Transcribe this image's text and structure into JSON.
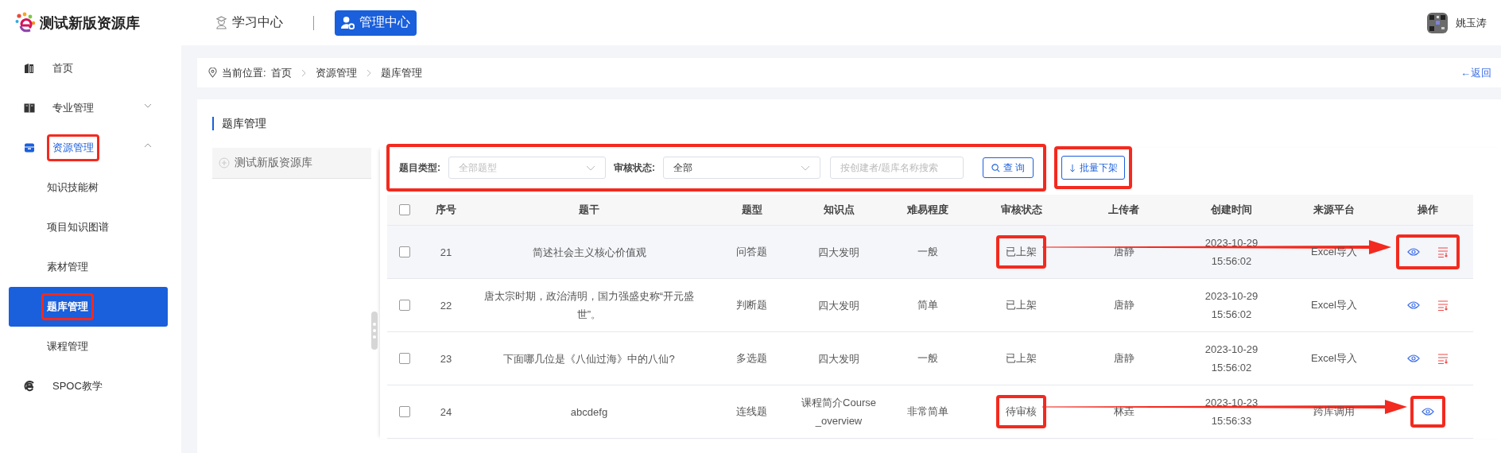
{
  "header": {
    "app_title": "测试新版资源库",
    "nav": [
      {
        "label": "学习中心",
        "kind": "learn",
        "selected": false
      },
      {
        "label": "管理中心",
        "kind": "admin",
        "selected": true
      }
    ],
    "user": {
      "name": "姚玉涛"
    }
  },
  "sidebar": {
    "items": [
      {
        "label": "首页",
        "selected": false,
        "highlighted": false
      },
      {
        "label": "专业管理",
        "selected": false,
        "highlighted": false,
        "expanded": false
      },
      {
        "label": "资源管理",
        "selected": false,
        "highlighted": true,
        "expanded": true,
        "children": [
          {
            "label": "知识技能树",
            "selected": false,
            "highlighted": false
          },
          {
            "label": "项目知识图谱",
            "selected": false,
            "highlighted": false
          },
          {
            "label": "素材管理",
            "selected": false,
            "highlighted": false
          },
          {
            "label": "题库管理",
            "selected": true,
            "highlighted": true
          },
          {
            "label": "课程管理",
            "selected": false,
            "highlighted": false
          }
        ]
      },
      {
        "label": "SPOC教学",
        "selected": false,
        "highlighted": false
      }
    ]
  },
  "breadcrumb": {
    "prefix": "当前位置:",
    "items": [
      "首页",
      "资源管理",
      "题库管理"
    ],
    "back": "←返回"
  },
  "page_title": "题库管理",
  "tree": {
    "items": [
      {
        "label": "测试新版资源库"
      }
    ]
  },
  "filters": {
    "highlighted": true,
    "type_label": "题目类型:",
    "type_select": {
      "placeholder": "全部题型"
    },
    "status_label": "审核状态:",
    "status_select": {
      "value": "全部"
    },
    "search": {
      "placeholder": "按创建者/题库名称搜索"
    },
    "query_button": "查 询",
    "batch_button": {
      "label": "批量下架",
      "highlighted": true
    }
  },
  "table": {
    "header_checked": false,
    "columns": [
      "序号",
      "题干",
      "题型",
      "知识点",
      "难易程度",
      "审核状态",
      "上传者",
      "创建时间",
      "来源平台",
      "操作"
    ],
    "rows": [
      {
        "checked": false,
        "hovered": true,
        "no": "21",
        "stem": "简述社会主义核心价值观",
        "type": "问答题",
        "knowledge": "四大发明",
        "difficulty": "一般",
        "status": "已上架",
        "status_highlighted": true,
        "uploader": "唐静",
        "created": "2023-10-29 15:56:02",
        "source": "Excel导入",
        "actions": [
          {
            "kind": "view"
          },
          {
            "kind": "unshelve"
          }
        ],
        "actions_highlighted": true,
        "arrow": true
      },
      {
        "checked": false,
        "hovered": false,
        "no": "22",
        "stem": "唐太宗时期，政治清明，国力强盛史称“开元盛世”。",
        "type": "判断题",
        "knowledge": "四大发明",
        "difficulty": "简单",
        "status": "已上架",
        "status_highlighted": false,
        "uploader": "唐静",
        "created": "2023-10-29 15:56:02",
        "source": "Excel导入",
        "actions": [
          {
            "kind": "view"
          },
          {
            "kind": "unshelve"
          }
        ],
        "actions_highlighted": false,
        "arrow": false
      },
      {
        "checked": false,
        "hovered": false,
        "no": "23",
        "stem": "下面哪几位是《八仙过海》中的八仙?",
        "type": "多选题",
        "knowledge": "四大发明",
        "difficulty": "一般",
        "status": "已上架",
        "status_highlighted": false,
        "uploader": "唐静",
        "created": "2023-10-29 15:56:02",
        "source": "Excel导入",
        "actions": [
          {
            "kind": "view"
          },
          {
            "kind": "unshelve"
          }
        ],
        "actions_highlighted": false,
        "arrow": false
      },
      {
        "checked": false,
        "hovered": false,
        "no": "24",
        "stem": "abcdefg",
        "type": "连线题",
        "knowledge": "课程简介Course_overview",
        "difficulty": "非常简单",
        "status": "待审核",
        "status_highlighted": true,
        "uploader": "林垚",
        "created": "2023-10-23 15:56:33",
        "source": "跨库调用",
        "actions": [
          {
            "kind": "view"
          }
        ],
        "actions_highlighted": true,
        "arrow": true
      }
    ]
  }
}
